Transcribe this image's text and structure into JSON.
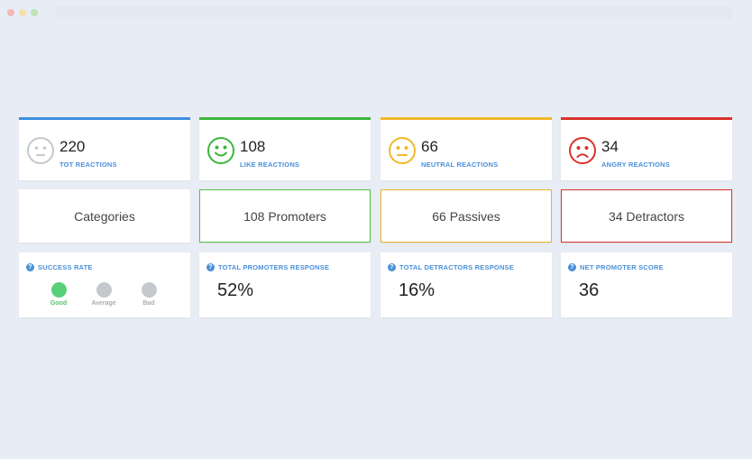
{
  "colors": {
    "blue": "#3d8fe0",
    "green": "#3cb73c",
    "yellow": "#f0b92a",
    "red": "#d9322b",
    "gray": "#c5c8cc"
  },
  "reactions": [
    {
      "count": "220",
      "label": "TOT REACTIONS",
      "icon": "neutral-gray-face-icon",
      "color": "#3d8fe0"
    },
    {
      "count": "108",
      "label": "LIKE REACTIONS",
      "icon": "smile-face-icon",
      "color": "#3cb73c"
    },
    {
      "count": "66",
      "label": "NEUTRAL REACTIONS",
      "icon": "neutral-face-icon",
      "color": "#f0b92a"
    },
    {
      "count": "34",
      "label": "ANGRY REACTIONS",
      "icon": "angry-face-icon",
      "color": "#d9322b"
    }
  ],
  "categories": {
    "title": "Categories",
    "promoters": "108 Promoters",
    "passives": "66 Passives",
    "detractors": "34 Detractors"
  },
  "metrics": {
    "success_rate": {
      "title": "SUCCESS RATE",
      "options": [
        "Good",
        "Average",
        "Bad"
      ],
      "selected": "Good"
    },
    "promoters_response": {
      "title": "TOTAL PROMOTERS RESPONSE",
      "value": "52%"
    },
    "detractors_response": {
      "title": "TOTAL DETRACTORS RESPONSE",
      "value": "16%"
    },
    "nps": {
      "title": "NET PROMOTER SCORE",
      "value": "36"
    }
  }
}
